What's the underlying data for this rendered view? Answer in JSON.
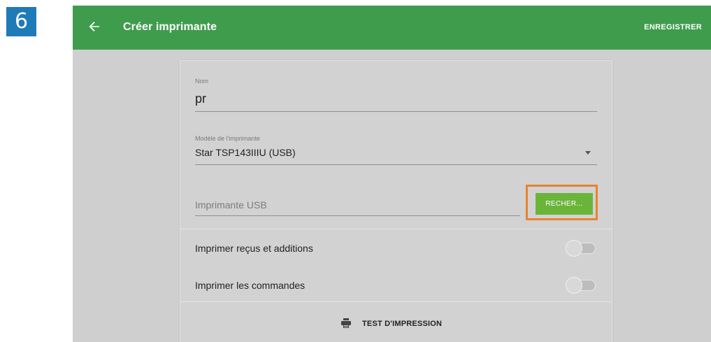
{
  "step": {
    "number": "6",
    "color": "#1f7ab8"
  },
  "header": {
    "back_icon": "arrow-left-icon",
    "title": "Créer imprimante",
    "save_label": "ENREGISTRER",
    "color": "#3f9c4d"
  },
  "form": {
    "name": {
      "label": "Nom",
      "value": "pr"
    },
    "model": {
      "label": "Modèle de l'imprimante",
      "value": "Star TSP143IIIU (USB)",
      "icon": "dropdown-arrow-icon"
    },
    "usb_printer": {
      "placeholder": "Imprimante USB",
      "search_label": "RECHER...",
      "search_color": "#6bb43a"
    },
    "highlight_color": "#e8832b",
    "toggles": [
      {
        "label": "Imprimer reçus et additions",
        "on": false
      },
      {
        "label": "Imprimer les commandes",
        "on": false
      }
    ],
    "test_print": {
      "icon": "printer-icon",
      "label": "TEST D'IMPRESSION"
    }
  }
}
